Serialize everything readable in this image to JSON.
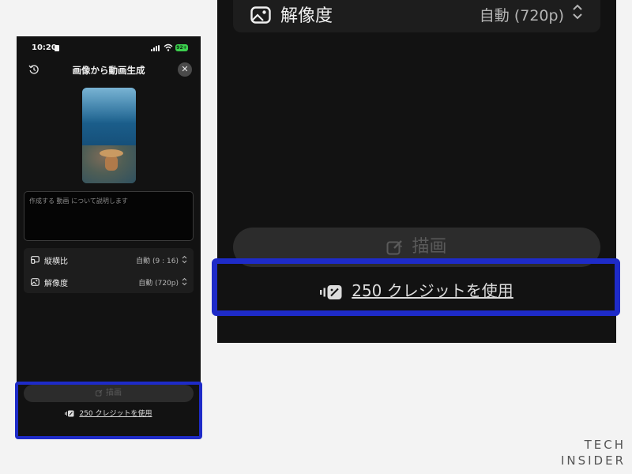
{
  "status_bar": {
    "time": "10:20",
    "battery": "92+"
  },
  "header": {
    "title": "画像から動画生成"
  },
  "prompt": {
    "placeholder": "作成する 動画 について説明します"
  },
  "settings": [
    {
      "label": "縦横比",
      "value": "自動 (9 : 16)",
      "icon": "aspect-ratio-icon"
    },
    {
      "label": "解像度",
      "value": "自動 (720p)",
      "icon": "image-icon"
    }
  ],
  "draw_button": {
    "label": "描画",
    "icon": "pen-sparkle-icon"
  },
  "credits": {
    "label": "250 クレジットを使用",
    "icon": "credits-icon"
  },
  "zoom": {
    "resolution_label": "解像度",
    "resolution_value": "自動 (720p)",
    "draw_label": "描画",
    "credits_label": "250 クレジットを使用"
  },
  "watermark": {
    "line1": "TECH",
    "line2": "INSIDER"
  },
  "colors": {
    "highlight": "#1e2bc8",
    "background": "#121212",
    "battery": "#3ccf4e"
  }
}
